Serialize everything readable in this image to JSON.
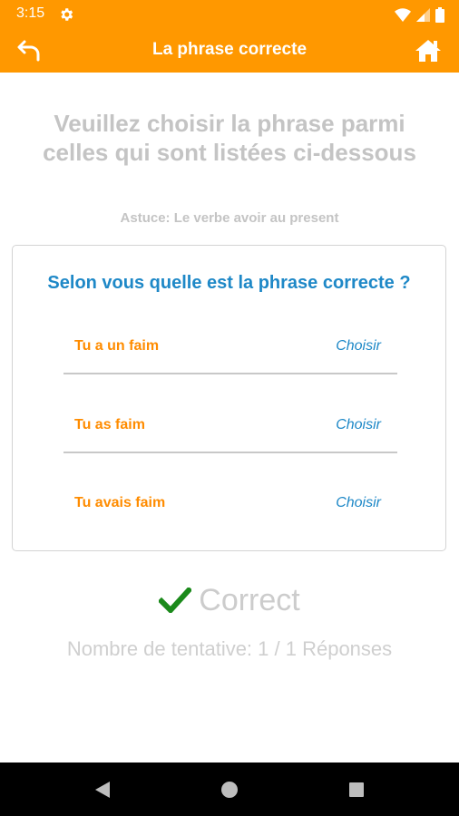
{
  "status_bar": {
    "time": "3:15",
    "icons": [
      "gear-icon",
      "wifi-icon",
      "signal-icon",
      "battery-icon"
    ]
  },
  "app_bar": {
    "title": "La phrase correcte",
    "back_icon": "back-arrow-icon",
    "home_icon": "home-icon"
  },
  "instruction": "Veuillez choisir la phrase parmi celles qui sont listées ci-dessous",
  "hint": "Astuce: Le verbe avoir au present",
  "card": {
    "question": "Selon vous quelle est la phrase correcte ?",
    "options": [
      {
        "text": "Tu a un faim",
        "action": "Choisir"
      },
      {
        "text": "Tu as faim",
        "action": "Choisir"
      },
      {
        "text": "Tu avais faim",
        "action": "Choisir"
      }
    ]
  },
  "result": {
    "icon": "checkmark-icon",
    "text": "Correct"
  },
  "attempts": "Nombre de tentative: 1 / 1 Réponses",
  "nav_bar": {
    "buttons": [
      "back-triangle-icon",
      "home-circle-icon",
      "recents-square-icon"
    ]
  },
  "colors": {
    "accent": "#ff9800",
    "question": "#1e88c7",
    "option": "#ff8c00",
    "check": "#1b8a1b",
    "muted": "#c4c4c4"
  }
}
